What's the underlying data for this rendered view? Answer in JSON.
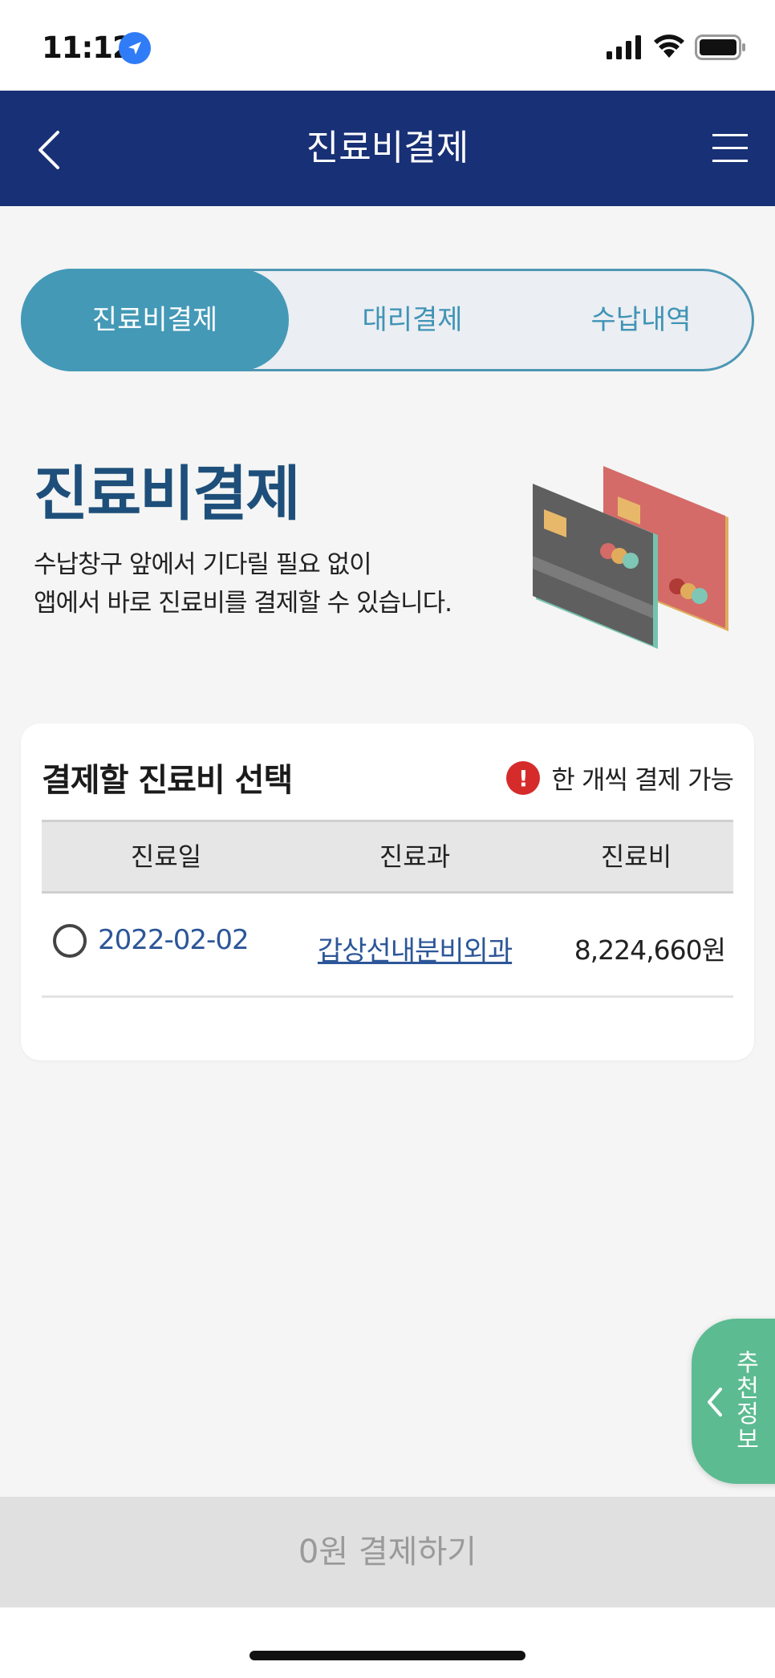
{
  "status_bar": {
    "time": "11:12"
  },
  "header": {
    "title": "진료비결제"
  },
  "tabs": [
    {
      "label": "진료비결제",
      "active": true
    },
    {
      "label": "대리결제",
      "active": false
    },
    {
      "label": "수납내역",
      "active": false
    }
  ],
  "hero": {
    "title": "진료비결제",
    "desc_line1": "수납창구 앞에서 기다릴 필요 없이",
    "desc_line2": "앱에서 바로 진료비를 결제할 수 있습니다."
  },
  "panel": {
    "title": "결제할 진료비 선택",
    "notice": "한 개씩 결제 가능",
    "columns": [
      "진료일",
      "진료과",
      "진료비"
    ],
    "rows": [
      {
        "date": "2022-02-02",
        "department": "갑상선내분비외과",
        "amount": "8,224,660원",
        "selected": false
      }
    ]
  },
  "reco_tab": {
    "chars": [
      "추",
      "천",
      "정",
      "보"
    ]
  },
  "pay_button": {
    "label": "0원 결제하기"
  },
  "colors": {
    "header_bg": "#183075",
    "tab_active": "#4499b7",
    "hero_title": "#1e4f7a",
    "link_blue": "#2c5698",
    "alert_red": "#d62b2b",
    "reco_green": "#5cbb91"
  }
}
